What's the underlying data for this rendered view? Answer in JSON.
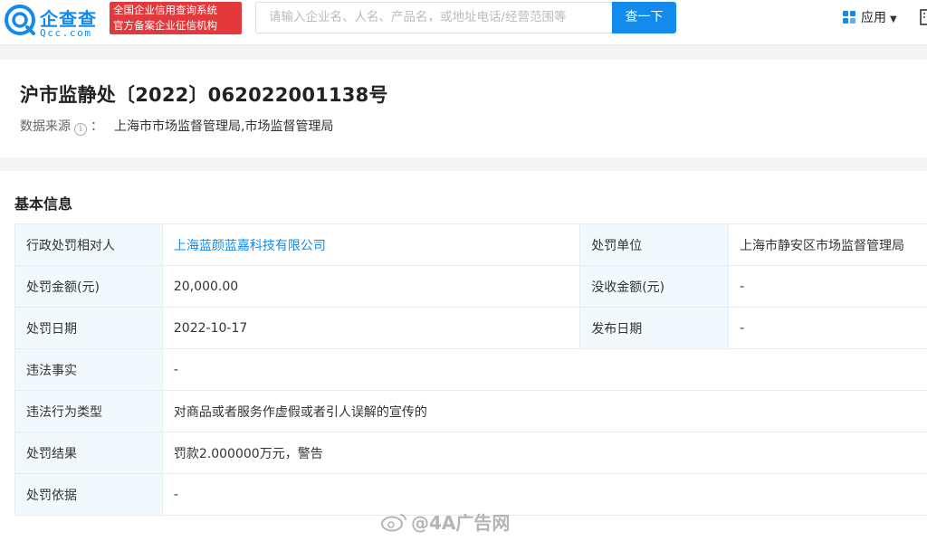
{
  "header": {
    "logo_cn": "企查查",
    "logo_en": "Qcc.com",
    "badge_line1": "全国企业信用查询系统",
    "badge_line2": "官方备案企业征信机构",
    "search_placeholder": "请输入企业名、人名、产品名，或地址电话/经营范围等",
    "search_button": "查一下",
    "apps_label": "应用",
    "brand_color": "#128bed",
    "badge_color": "#e4393c"
  },
  "document": {
    "title": "沪市监静处〔2022〕062022001138号",
    "source_label": "数据来源",
    "source_colon": "：",
    "source_value": "上海市市场监督管理局,市场监督管理局"
  },
  "basic_info": {
    "section_title": "基本信息",
    "party_label": "行政处罚相对人",
    "party_value": "上海蓝颜蓝嘉科技有限公司",
    "authority_label": "处罚单位",
    "authority_value": "上海市静安区市场监督管理局",
    "amount_label": "处罚金额(元)",
    "amount_value": "20,000.00",
    "confiscated_label": "没收金额(元)",
    "confiscated_value": "-",
    "date_label": "处罚日期",
    "date_value": "2022-10-17",
    "publish_label": "发布日期",
    "publish_value": "-",
    "facts_label": "违法事实",
    "facts_value": "-",
    "type_label": "违法行为类型",
    "type_value": "对商品或者服务作虚假或者引人误解的宣传的",
    "result_label": "处罚结果",
    "result_value": "罚款2.000000万元，警告",
    "basis_label": "处罚依据",
    "basis_value": "-"
  },
  "watermark": {
    "text": "@4A广告网"
  }
}
